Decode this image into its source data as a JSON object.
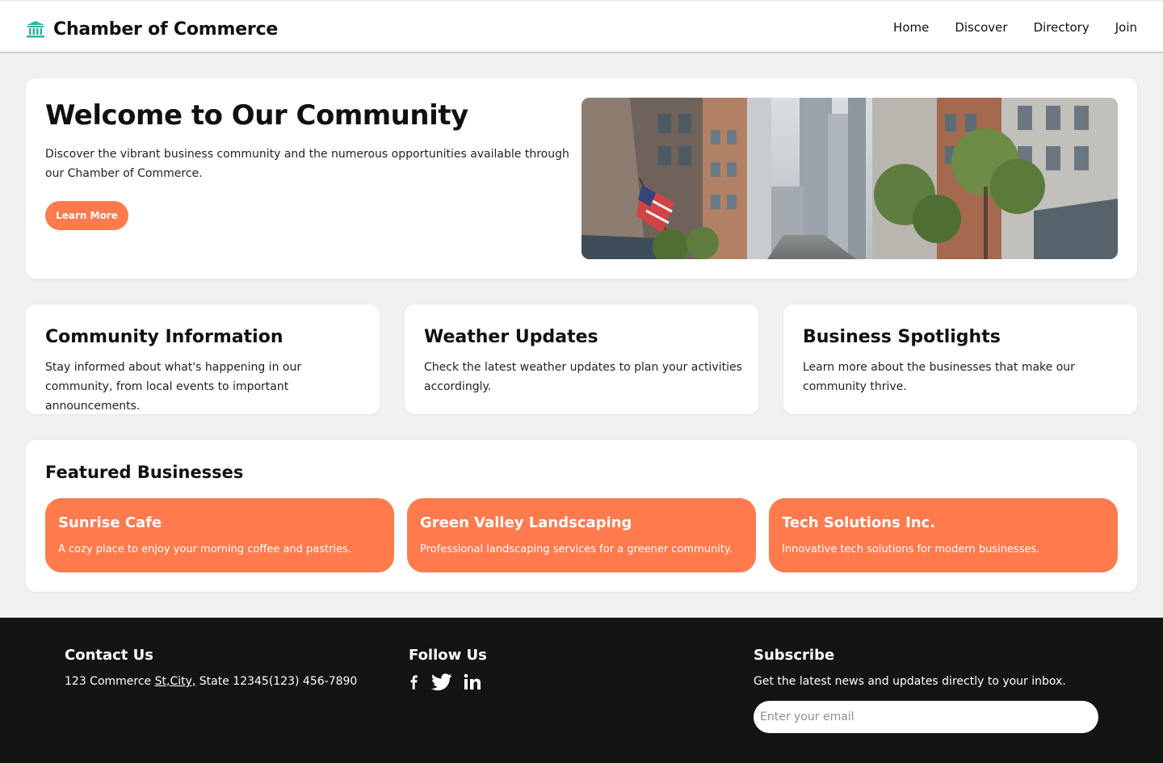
{
  "header": {
    "brand": "Chamber of Commerce",
    "nav": [
      "Home",
      "Discover",
      "Directory",
      "Join"
    ]
  },
  "hero": {
    "title": "Welcome to Our Community",
    "text": "Discover the vibrant business community and the numerous opportunities available through our Chamber of Commerce.",
    "button": "Learn More"
  },
  "info_cards": [
    {
      "title": "Community Information",
      "text": "Stay informed about what's happening in our community, from local events to important announcements."
    },
    {
      "title": "Weather Updates",
      "text": "Check the latest weather updates to plan your activities accordingly."
    },
    {
      "title": "Business Spotlights",
      "text": "Learn more about the businesses that make our community thrive."
    }
  ],
  "featured": {
    "title": "Featured Businesses",
    "businesses": [
      {
        "name": "Sunrise Cafe",
        "desc": "A cozy place to enjoy your morning coffee and pastries."
      },
      {
        "name": "Green Valley Landscaping",
        "desc": "Professional landscaping services for a greener community."
      },
      {
        "name": "Tech Solutions Inc.",
        "desc": "Innovative tech solutions for modern businesses."
      }
    ]
  },
  "footer": {
    "contact_title": "Contact Us",
    "address_start": "123 Commerce ",
    "address_link": "St,City,",
    "address_end": " State 12345(123) 456-7890",
    "follow_title": "Follow Us",
    "social_icons": [
      "facebook-icon",
      "twitter-icon",
      "linkedin-icon"
    ],
    "subscribe_title": "Subscribe",
    "subscribe_text": "Get the latest news and updates directly to your inbox.",
    "email_placeholder": "Enter your email"
  },
  "colors": {
    "accent": "#ff7a4d",
    "brand_icon": "#2bb5a0",
    "footer_bg": "#141414",
    "page_bg": "#f1f1f1"
  }
}
